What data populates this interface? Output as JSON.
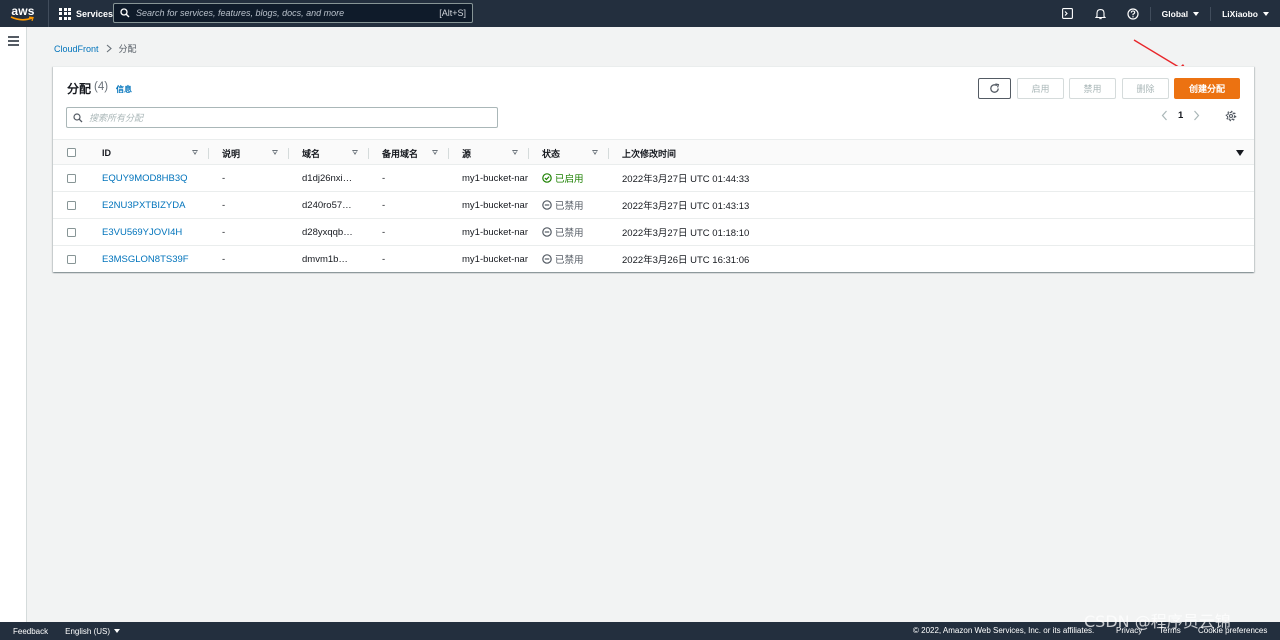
{
  "topnav": {
    "logo_text": "aws",
    "services_label": "Services",
    "search_placeholder": "Search for services, features, blogs, docs, and more",
    "search_shortcut": "[Alt+S]",
    "region": "Global",
    "user": "LiXiaobo"
  },
  "breadcrumb": {
    "root": "CloudFront",
    "current": "分配"
  },
  "panel": {
    "title": "分配",
    "count": "(4)",
    "info": "信息",
    "buttons": {
      "enable": "启用",
      "disable": "禁用",
      "delete": "删除",
      "create": "创建分配"
    },
    "filter_placeholder": "搜索所有分配",
    "page": "1"
  },
  "table": {
    "columns": [
      "ID",
      "说明",
      "域名",
      "备用域名",
      "源",
      "状态",
      "上次修改时间"
    ],
    "rows": [
      {
        "id": "EQUY9MOD8HB3Q",
        "desc": "-",
        "domain": "d1dj26nxi…",
        "alt": "-",
        "origin": "my1-bucket-nar",
        "status": "已启用",
        "modified": "2022年3月27日 UTC 01:44:33"
      },
      {
        "id": "E2NU3PXTBIZYDA",
        "desc": "-",
        "domain": "d240ro57…",
        "alt": "-",
        "origin": "my1-bucket-nar",
        "status": "已禁用",
        "modified": "2022年3月27日 UTC 01:43:13"
      },
      {
        "id": "E3VU569YJOVI4H",
        "desc": "-",
        "domain": "d28yxqqb…",
        "alt": "-",
        "origin": "my1-bucket-nar",
        "status": "已禁用",
        "modified": "2022年3月27日 UTC 01:18:10"
      },
      {
        "id": "E3MSGLON8TS39F",
        "desc": "-",
        "domain": "dmvm1b…",
        "alt": "-",
        "origin": "my1-bucket-nar",
        "status": "已禁用",
        "modified": "2022年3月26日 UTC 16:31:06"
      }
    ]
  },
  "footer": {
    "feedback": "Feedback",
    "language": "English (US)",
    "copyright": "© 2022, Amazon Web Services, Inc. or its affiliates.",
    "privacy": "Privacy",
    "terms": "Terms",
    "cookie": "Cookie preferences"
  },
  "watermark": "CSDN @程序员云锦",
  "colors": {
    "nav_bg": "#232f3e",
    "primary_orange": "#ec7211",
    "link_blue": "#0073bb",
    "success_green": "#1d8102",
    "annotation_red": "#e8262a"
  }
}
